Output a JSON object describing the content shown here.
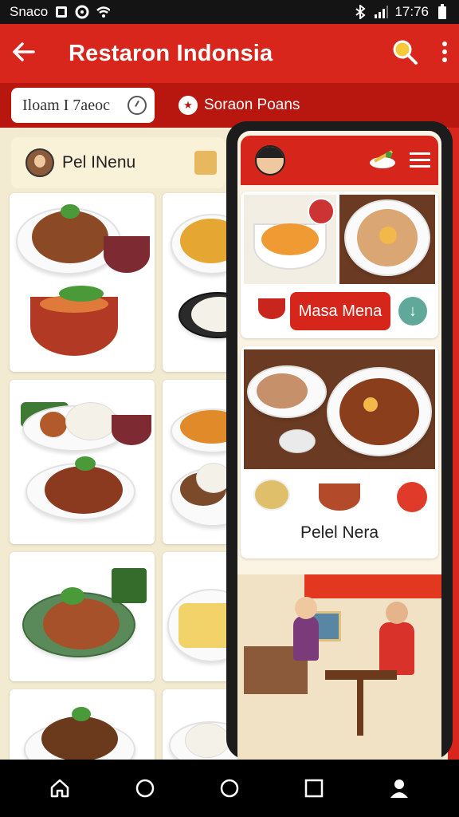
{
  "status_bar": {
    "carrier": "Snaco",
    "time": "17:76"
  },
  "app_bar": {
    "title": "Restaron Indonsia"
  },
  "filter_bar": {
    "search_value": "Iloam I 7aeoc",
    "link_label": "Soraon Poans"
  },
  "menu": {
    "title": "Pel INenu"
  },
  "phone_app": {
    "button_label": "Masa Mena",
    "section_label": "Pelel Nera"
  },
  "colors": {
    "brand_red": "#d8261c",
    "dark_red": "#b8170f",
    "cream": "#f3ead2",
    "teal": "#5fa89a"
  },
  "icons": {
    "status": [
      "notification-icon",
      "settings-icon",
      "wifi-icon",
      "bluetooth-icon",
      "signal-icon",
      "battery-icon"
    ],
    "app_bar": [
      "back-arrow-icon",
      "search-icon",
      "more-vert-icon"
    ],
    "nav": [
      "home-icon",
      "circle-icon",
      "circle-icon",
      "square-icon",
      "profile-icon"
    ]
  }
}
